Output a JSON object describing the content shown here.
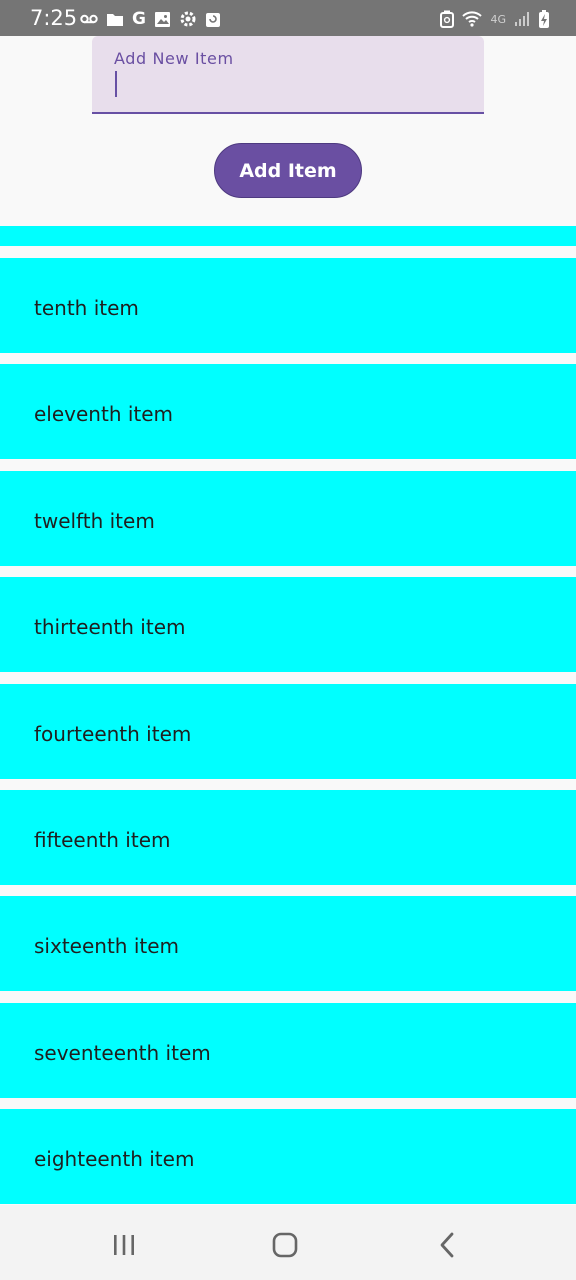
{
  "status_bar": {
    "time": "7:25",
    "left_icons": [
      "voicemail-icon",
      "folder-icon",
      "google-icon",
      "image-icon",
      "settings-icon",
      "calendar-icon"
    ],
    "right_icons": [
      "battery-saver-icon",
      "wifi-icon",
      "network-4g-icon",
      "signal-icon",
      "battery-charging-icon"
    ],
    "network_label": "4G"
  },
  "form": {
    "label": "Add New Item",
    "value": "",
    "button_label": "Add Item"
  },
  "list": {
    "items": [
      {
        "label": ""
      },
      {
        "label": "tenth item"
      },
      {
        "label": "eleventh item"
      },
      {
        "label": "twelfth item"
      },
      {
        "label": "thirteenth item"
      },
      {
        "label": "fourteenth item"
      },
      {
        "label": "fifteenth item"
      },
      {
        "label": "sixteenth item"
      },
      {
        "label": "seventeenth item"
      },
      {
        "label": "eighteenth item"
      }
    ]
  },
  "nav_bar": {
    "buttons": [
      "recent-apps-icon",
      "home-icon",
      "back-icon"
    ]
  },
  "colors": {
    "status_bar": "#757575",
    "accent": "#6750a4",
    "input_fill": "#e8deec",
    "list_item": "#00ffff",
    "background": "#f9f9f9"
  }
}
